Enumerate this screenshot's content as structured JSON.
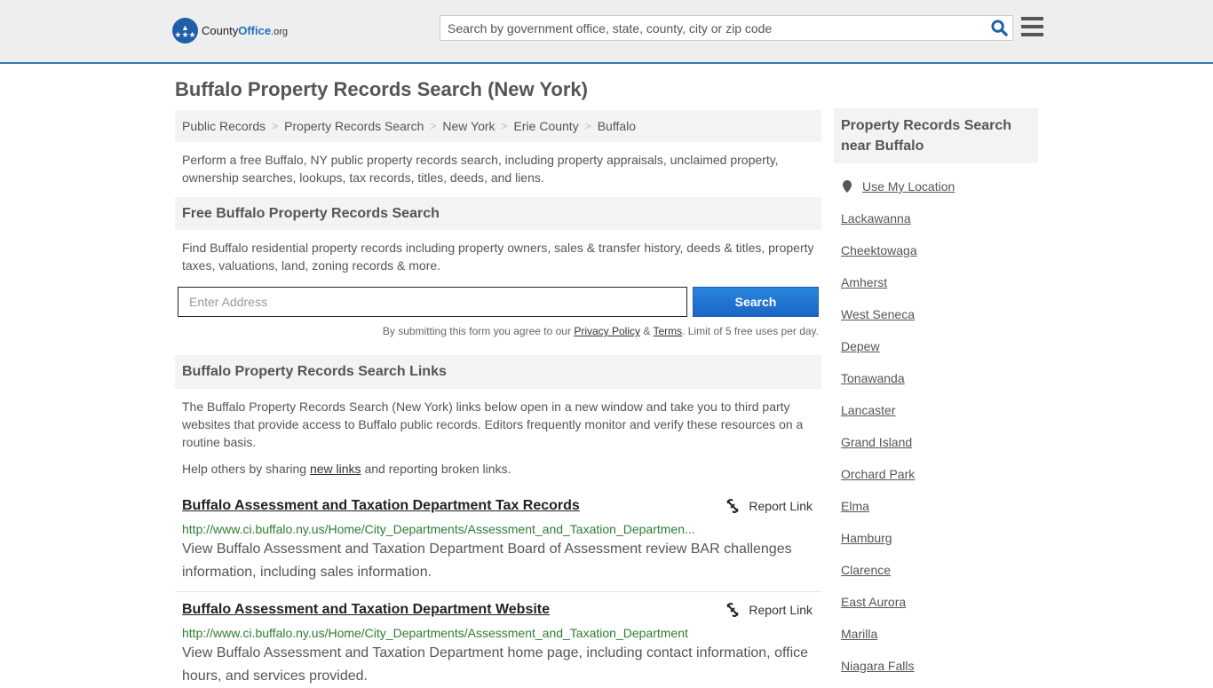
{
  "header": {
    "logo_name": "County",
    "logo_brand": "Office",
    "logo_tld": ".org",
    "search_placeholder": "Search by government office, state, county, city or zip code"
  },
  "page_title": "Buffalo Property Records Search (New York)",
  "breadcrumb": [
    "Public Records",
    "Property Records Search",
    "New York",
    "Erie County",
    "Buffalo"
  ],
  "intro": "Perform a free Buffalo, NY public property records search, including property appraisals, unclaimed property, ownership searches, lookups, tax records, titles, deeds, and liens.",
  "free_search": {
    "heading": "Free Buffalo Property Records Search",
    "text": "Find Buffalo residential property records including property owners, sales & transfer history, deeds & titles, property taxes, valuations, land, zoning records & more.",
    "address_placeholder": "Enter Address",
    "button": "Search",
    "disclaimer_pre": "By submitting this form you agree to our ",
    "privacy": "Privacy Policy",
    "amp": " & ",
    "terms": "Terms",
    "disclaimer_post": ". Limit of 5 free uses per day."
  },
  "links_section": {
    "heading": "Buffalo Property Records Search Links",
    "text": "The Buffalo Property Records Search (New York) links below open in a new window and take you to third party websites that provide access to Buffalo public records. Editors frequently monitor and verify these resources on a routine basis.",
    "help_pre": "Help others by sharing ",
    "help_link": "new links",
    "help_post": " and reporting broken links.",
    "report_label": "Report Link",
    "items": [
      {
        "title": "Buffalo Assessment and Taxation Department Tax Records",
        "url": "http://www.ci.buffalo.ny.us/Home/City_Departments/Assessment_and_Taxation_Departmen...",
        "desc": "View Buffalo Assessment and Taxation Department Board of Assessment review BAR challenges information, including sales information."
      },
      {
        "title": "Buffalo Assessment and Taxation Department Website",
        "url": "http://www.ci.buffalo.ny.us/Home/City_Departments/Assessment_and_Taxation_Department",
        "desc": "View Buffalo Assessment and Taxation Department home page, including contact information, office hours, and services provided."
      }
    ]
  },
  "sidebar": {
    "heading": "Property Records Search near Buffalo",
    "use_location": "Use My Location",
    "cities": [
      "Lackawanna",
      "Cheektowaga",
      "Amherst",
      "West Seneca",
      "Depew",
      "Tonawanda",
      "Lancaster",
      "Grand Island",
      "Orchard Park",
      "Elma",
      "Hamburg",
      "Clarence",
      "East Aurora",
      "Marilla",
      "Niagara Falls"
    ]
  }
}
